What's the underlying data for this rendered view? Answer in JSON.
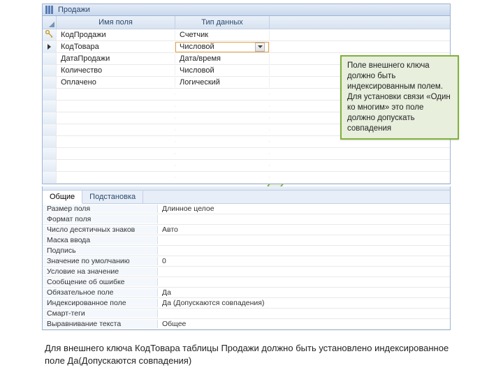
{
  "header": {
    "title": "Продажи"
  },
  "columns": {
    "name": "Имя поля",
    "type": "Тип данных"
  },
  "rows": [
    {
      "name": "КодПродажи",
      "type": "Счетчик",
      "pk": true
    },
    {
      "name": "КодТовара",
      "type": "Числовой",
      "active": true
    },
    {
      "name": "ДатаПродажи",
      "type": "Дата/время"
    },
    {
      "name": "Количество",
      "type": "Числовой"
    },
    {
      "name": "Оплачено",
      "type": "Логический"
    }
  ],
  "prop_tabs": {
    "general": "Общие",
    "lookup": "Подстановка"
  },
  "props": [
    {
      "label": "Размер поля",
      "value": "Длинное целое"
    },
    {
      "label": "Формат поля",
      "value": ""
    },
    {
      "label": "Число десятичных знаков",
      "value": "Авто"
    },
    {
      "label": "Маска ввода",
      "value": ""
    },
    {
      "label": "Подпись",
      "value": ""
    },
    {
      "label": "Значение по умолчанию",
      "value": "0"
    },
    {
      "label": "Условие на значение",
      "value": ""
    },
    {
      "label": "Сообщение об ошибке",
      "value": ""
    },
    {
      "label": "Обязательное поле",
      "value": "Да"
    },
    {
      "label": "Индексированное поле",
      "value": "Да (Допускаются совпадения)"
    },
    {
      "label": "Смарт-теги",
      "value": ""
    },
    {
      "label": "Выравнивание текста",
      "value": "Общее"
    }
  ],
  "callout": "Поле внешнего ключа должно быть индексированным полем. Для установки связи «Один ко многим» это поле должно допускать совпадения",
  "footnote": "Для внешнего ключа КодТовара таблицы Продажи должно быть установлено индексированное поле Да(Допускаются совпадения)"
}
